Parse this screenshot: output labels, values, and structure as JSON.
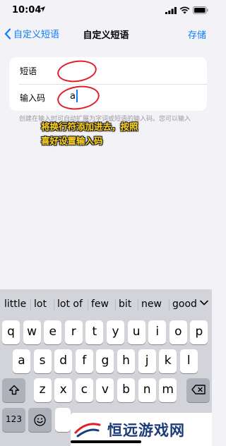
{
  "status_bar": {
    "time": "10:04"
  },
  "nav": {
    "back_label": "自定义短语",
    "title": "自定义短语",
    "save_label": "存储"
  },
  "form": {
    "phrase_label": "短语",
    "phrase_value": "",
    "shortcut_label": "输入码",
    "shortcut_value": "a"
  },
  "help_text": "创建在输入时可自动扩展为字词或短语的输入码。您可以输入",
  "overlay_caption": [
    "将换行符添加进去，按照",
    "喜好设置输入码"
  ],
  "keyboard": {
    "suggestions": [
      "little",
      "lot",
      "lot of",
      "few",
      "bit",
      "new",
      "good"
    ],
    "row1": [
      "q",
      "w",
      "e",
      "r",
      "t",
      "y",
      "u",
      "i",
      "o",
      "p"
    ],
    "row2": [
      "a",
      "s",
      "d",
      "f",
      "g",
      "h",
      "j",
      "k",
      "l"
    ],
    "row3": [
      "z",
      "x",
      "c",
      "v",
      "b",
      "n",
      "m"
    ],
    "numbers_label": "123"
  },
  "watermark": {
    "text": "恒远游戏网"
  },
  "colors": {
    "accent": "#0a7cff",
    "annotation_red": "#e11f2a",
    "caption_yellow": "#ffd21c",
    "keyboard_bg": "#d2d4da"
  }
}
